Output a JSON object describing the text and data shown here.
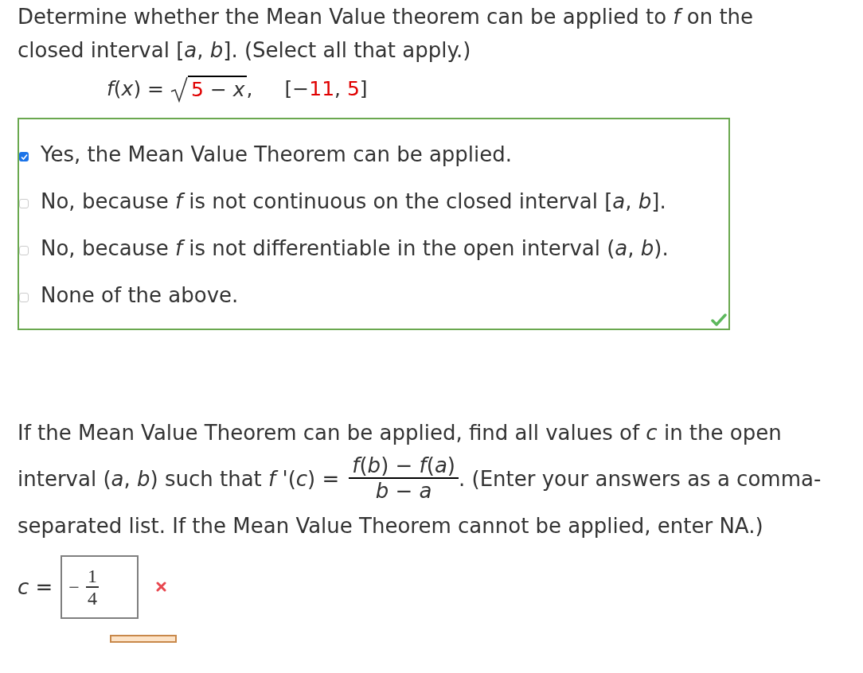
{
  "question": {
    "text": "Determine whether the Mean Value theorem can be applied to *f* on the closed interval [*a*, *b*]. (Select all that apply.)",
    "function": {
      "lhs": "*f*(*x*) =",
      "radicand": [
        {
          "text": "5",
          "highlight": true
        },
        {
          "text": " − *x*",
          "highlight": false
        }
      ],
      "after": ",",
      "interval": [
        {
          "text": "[−",
          "highlight": false
        },
        {
          "text": "11",
          "highlight": true
        },
        {
          "text": ", ",
          "highlight": false
        },
        {
          "text": "5",
          "highlight": true
        },
        {
          "text": "]",
          "highlight": false
        }
      ]
    }
  },
  "options": [
    {
      "text": "Yes, the Mean Value Theorem can be applied.",
      "checked": true
    },
    {
      "text": "No, because *f* is not continuous on the closed interval [*a*, *b*].",
      "checked": false
    },
    {
      "text": "No, because *f* is not differentiable in the open interval (*a*, *b*).",
      "checked": false
    },
    {
      "text": "None of the above.",
      "checked": false
    }
  ],
  "options_correct": true,
  "part2": {
    "before": "If the Mean Value Theorem can be applied, find all values of *c* in the open interval (*a*, *b*) such that *f* '(*c*) =",
    "numerator": "*f*(*b*) − *f*(*a*)",
    "denominator": "*b* − *a*",
    "after": ". (Enter your answers as a comma-separated list. If the Mean Value Theorem cannot be applied, enter NA.)"
  },
  "answer": {
    "label": "*c* =",
    "sign": "−",
    "numerator": "1",
    "denominator": "4",
    "correct": false
  }
}
